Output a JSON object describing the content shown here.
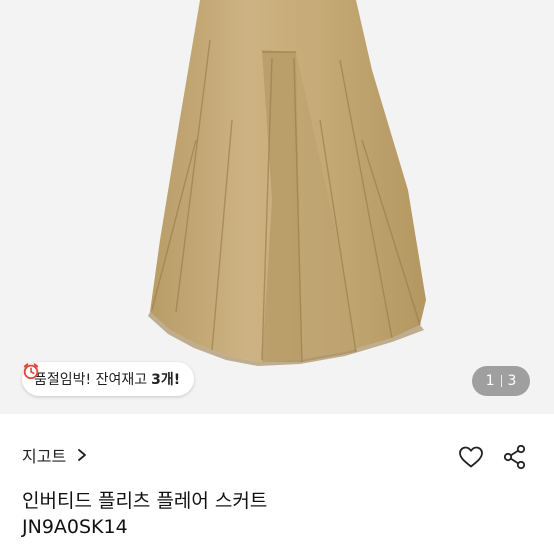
{
  "product_image": {
    "icon": "skirt-image"
  },
  "stock_badge": {
    "icon": "alarm-clock-icon",
    "text": "품절임박! 잔여재고",
    "quantity": "3개!"
  },
  "pager": {
    "current": "1",
    "total": "3"
  },
  "brand": {
    "name": "지고트",
    "icon": "chevron-right-icon"
  },
  "actions": {
    "like_icon": "heart-icon",
    "share_icon": "share-icon"
  },
  "product": {
    "title": "인버티드 플리츠 플레어 스커트",
    "code": "JN9A0SK14"
  },
  "colors": {
    "skirt": "#c7ad7b",
    "background": "#f3f3f3",
    "clock": "#e0453a"
  }
}
